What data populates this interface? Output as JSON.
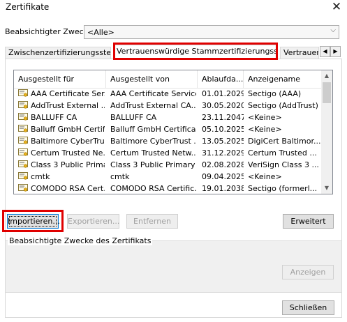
{
  "window": {
    "title": "Zertifikate",
    "close_glyph": "✕"
  },
  "purpose": {
    "label": "Beabsichtigter Zweck:",
    "value": "<Alle>",
    "arrow": "⌵"
  },
  "tabs": [
    {
      "label": "Zwischenzertifizierungsstellen",
      "active": false
    },
    {
      "label": "Vertrauenswürdige Stammzertifizierungsstellen",
      "active": true
    },
    {
      "label": "Vertrauens",
      "active": false
    }
  ],
  "tab_scroll": {
    "left": "◀",
    "right": "▶"
  },
  "list": {
    "columns": [
      "Ausgestellt für",
      "Ausgestellt von",
      "Ablaufda...",
      "Anzeigename"
    ],
    "rows": [
      [
        "AAA Certificate Ser...",
        "AAA Certificate Services",
        "01.01.2029",
        "Sectigo (AAA)"
      ],
      [
        "AddTrust External ...",
        "AddTrust External CA...",
        "30.05.2020",
        "Sectigo (AddTrust)"
      ],
      [
        "BALLUFF CA",
        "BALLUFF CA",
        "23.11.2047",
        "<Keine>"
      ],
      [
        "Balluff GmbH Certifi...",
        "Balluff GmbH Certifica...",
        "05.10.2025",
        "<Keine>"
      ],
      [
        "Baltimore CyberTrus...",
        "Baltimore CyberTrust ...",
        "13.05.2025",
        "DigiCert Baltimor..."
      ],
      [
        "Certum Trusted Ne...",
        "Certum Trusted Netw...",
        "31.12.2029",
        "Certum Trusted ..."
      ],
      [
        "Class 3 Public Prima...",
        "Class 3 Public Primary ...",
        "02.08.2028",
        "VeriSign Class 3 ..."
      ],
      [
        "cmtk",
        "cmtk",
        "09.04.2025",
        "<Keine>"
      ],
      [
        "COMODO RSA Cert...",
        "COMODO RSA Certific...",
        "19.01.2038",
        "Sectigo (formerl..."
      ]
    ],
    "scroll_up": "▲",
    "scroll_down": "▼"
  },
  "buttons": {
    "import": "Importieren...",
    "export": "Exportieren...",
    "remove": "Entfernen",
    "advanced": "Erweitert",
    "view": "Anzeigen",
    "close": "Schließen"
  },
  "purposes_group": {
    "label": "Beabsichtigte Zwecke des Zertifikats"
  },
  "colors": {
    "highlight": "#e00000",
    "accent": "#0078d7"
  }
}
